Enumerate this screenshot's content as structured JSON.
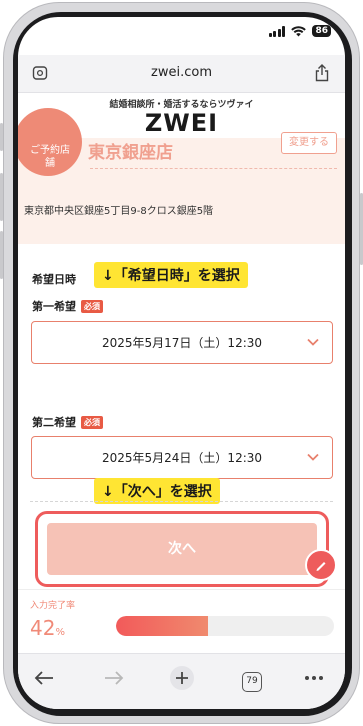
{
  "status_bar": {
    "battery": "86"
  },
  "browser": {
    "url": "zwei.com",
    "tabs_count": "79"
  },
  "site": {
    "tagline": "結婚相談所・婚活するならツヴァイ",
    "logo": "ZWEI"
  },
  "store": {
    "badge_label": "ご予約店舗",
    "name": "東京銀座店",
    "change_label": "変更する",
    "address": "東京都中央区銀座5丁目9-8クロス銀座5階"
  },
  "form": {
    "preferred_datetime_label": "希望日時",
    "first_choice": {
      "label": "第一希望",
      "required": "必須",
      "value": "2025年5月17日（土）12:30"
    },
    "second_choice": {
      "label": "第二希望",
      "required": "必須",
      "value": "2025年5月24日（土）12:30"
    },
    "next_label": "次へ"
  },
  "annotations": {
    "select_datetime": "↓「希望日時」を選択",
    "select_next": "↓「次へ」を選択"
  },
  "progress": {
    "label": "入力完了率",
    "percent": 42,
    "value_text": "42",
    "unit": "%"
  },
  "colors": {
    "accent": "#ee5c5c",
    "highlight": "#ffe533",
    "soft": "#f6c2b6"
  },
  "icons": [
    "signal-icon",
    "wifi-icon",
    "battery-icon",
    "page-settings-icon",
    "share-icon",
    "chevron-down-icon",
    "pencil-icon",
    "back-icon",
    "forward-icon",
    "new-tab-icon",
    "tabs-icon",
    "more-icon"
  ]
}
